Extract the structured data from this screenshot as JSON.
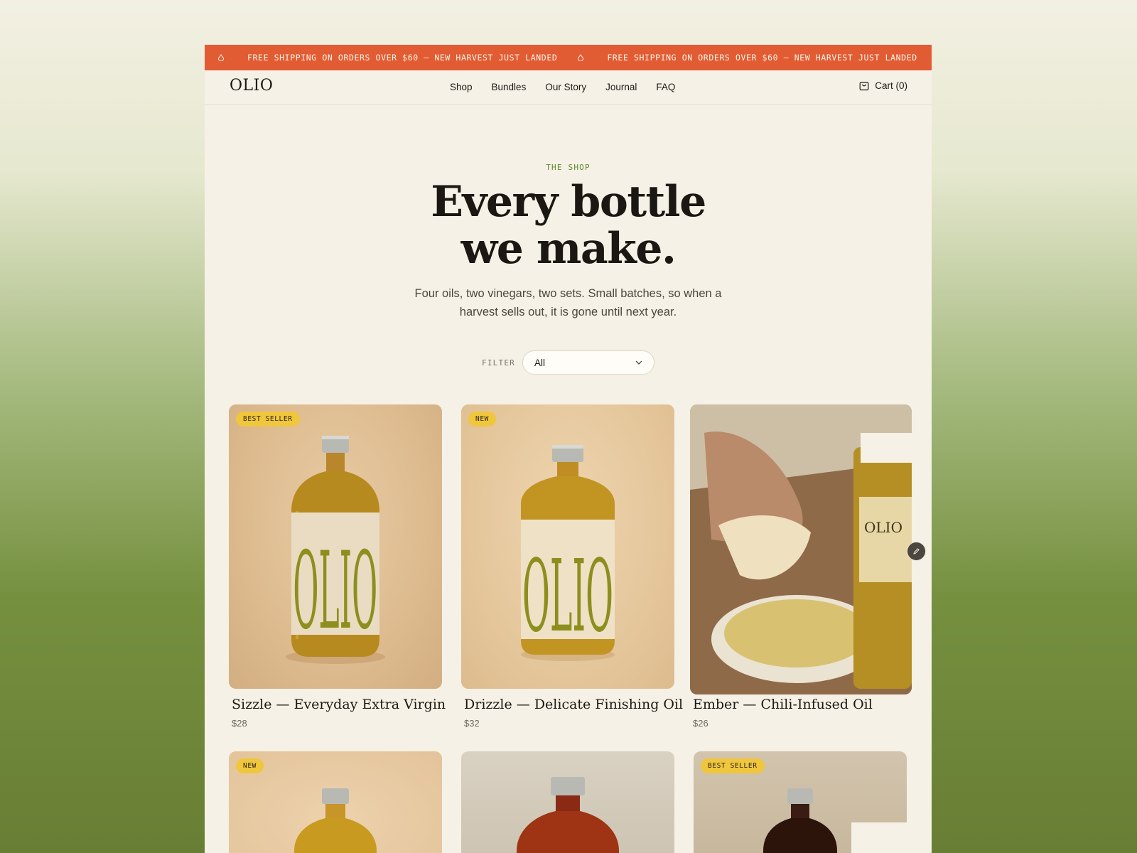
{
  "announcement": {
    "text_1": "FREE SHIPPING ON ORDERS OVER $60 — NEW HARVEST JUST LANDED",
    "text_2": "FREE SHIPPING ON ORDERS OVER $60 — NEW HARVEST JUST LANDED"
  },
  "header": {
    "logo": "OLIO",
    "nav": [
      "Shop",
      "Bundles",
      "Our Story",
      "Journal",
      "FAQ"
    ],
    "cart_label": "Cart (0)"
  },
  "hero": {
    "eyebrow": "THE SHOP",
    "headline_1": "Every bottle",
    "headline_2": "we make.",
    "subcopy": "Four oils, two vinegars, two sets. Small batches, so when a harvest sells out, it is gone until next year."
  },
  "filter": {
    "label": "FILTER",
    "selected": "All"
  },
  "products": [
    {
      "badge": "BEST SELLER",
      "title": "Sizzle — Everyday Extra Virgin",
      "price": "$28",
      "label_text": "OLIO"
    },
    {
      "badge": "NEW",
      "title": "Drizzle — Delicate Finishing Oil",
      "price": "$32",
      "label_text": "OLIO"
    },
    {
      "badge": "",
      "title": "Ember — Chili-Infused Oil",
      "price": "$26",
      "label_text": "OLIO"
    },
    {
      "badge": "NEW",
      "title": "",
      "price": ""
    },
    {
      "badge": "",
      "title": "",
      "price": ""
    },
    {
      "badge": "BEST SELLER",
      "title": "",
      "price": ""
    }
  ],
  "colors": {
    "announcement_bg": "#e25c33",
    "page_bg": "#f6f1e6",
    "badge": "#f0c63c",
    "eyebrow": "#5f8a2c",
    "label_olive": "#8c8f1e"
  }
}
